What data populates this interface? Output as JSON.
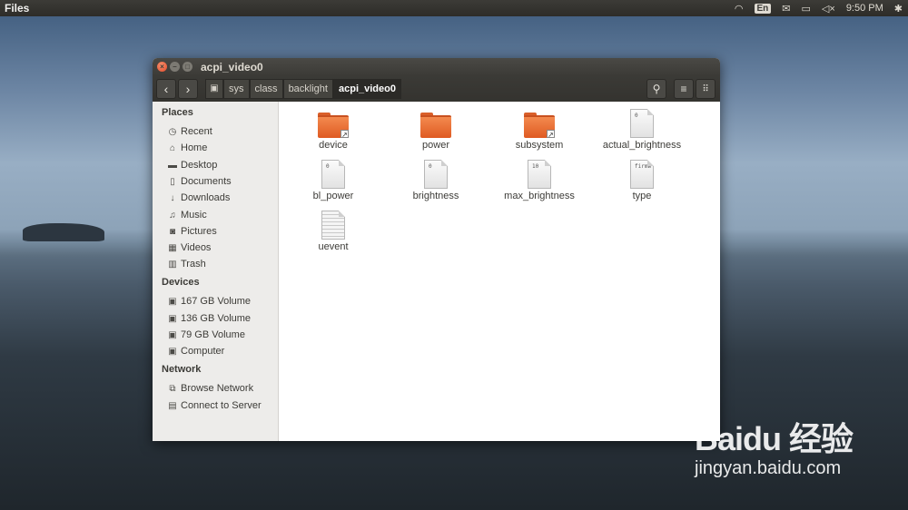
{
  "topbar": {
    "app_title": "Files",
    "language": "En",
    "clock": "9:50 PM",
    "tray_icons": [
      "wifi-icon",
      "language-indicator",
      "mail-icon",
      "battery-icon",
      "volume-muted-icon",
      "gear-icon"
    ]
  },
  "window": {
    "title": "acpi_video0",
    "breadcrumbs": [
      "sys",
      "class",
      "backlight",
      "acpi_video0"
    ]
  },
  "sidebar": {
    "places_heading": "Places",
    "places": [
      {
        "label": "Recent",
        "icon": "clock-icon"
      },
      {
        "label": "Home",
        "icon": "home-icon"
      },
      {
        "label": "Desktop",
        "icon": "desktop-icon"
      },
      {
        "label": "Documents",
        "icon": "document-icon"
      },
      {
        "label": "Downloads",
        "icon": "download-icon"
      },
      {
        "label": "Music",
        "icon": "music-icon"
      },
      {
        "label": "Pictures",
        "icon": "camera-icon"
      },
      {
        "label": "Videos",
        "icon": "film-icon"
      },
      {
        "label": "Trash",
        "icon": "trash-icon"
      }
    ],
    "devices_heading": "Devices",
    "devices": [
      {
        "label": "167 GB Volume",
        "icon": "drive-icon"
      },
      {
        "label": "136 GB Volume",
        "icon": "drive-icon"
      },
      {
        "label": "79 GB Volume",
        "icon": "drive-icon"
      },
      {
        "label": "Computer",
        "icon": "drive-icon"
      }
    ],
    "network_heading": "Network",
    "network": [
      {
        "label": "Browse Network",
        "icon": "network-icon"
      },
      {
        "label": "Connect to Server",
        "icon": "server-icon"
      }
    ]
  },
  "files": [
    {
      "name": "device",
      "kind": "folder-link"
    },
    {
      "name": "power",
      "kind": "folder"
    },
    {
      "name": "subsystem",
      "kind": "folder-link"
    },
    {
      "name": "actual_brightness",
      "kind": "text",
      "preview": "0"
    },
    {
      "name": "bl_power",
      "kind": "text",
      "preview": "0"
    },
    {
      "name": "brightness",
      "kind": "text",
      "preview": "0"
    },
    {
      "name": "max_brightness",
      "kind": "text",
      "preview": "10"
    },
    {
      "name": "type",
      "kind": "text",
      "preview": "firmw"
    },
    {
      "name": "uevent",
      "kind": "text-lines",
      "preview": ""
    }
  ],
  "watermark": {
    "brand": "Baidu 经验",
    "url": "jingyan.baidu.com"
  },
  "colors": {
    "accent": "#e2492a",
    "folder": "#f38a4f",
    "panel": "#3c3b37"
  }
}
